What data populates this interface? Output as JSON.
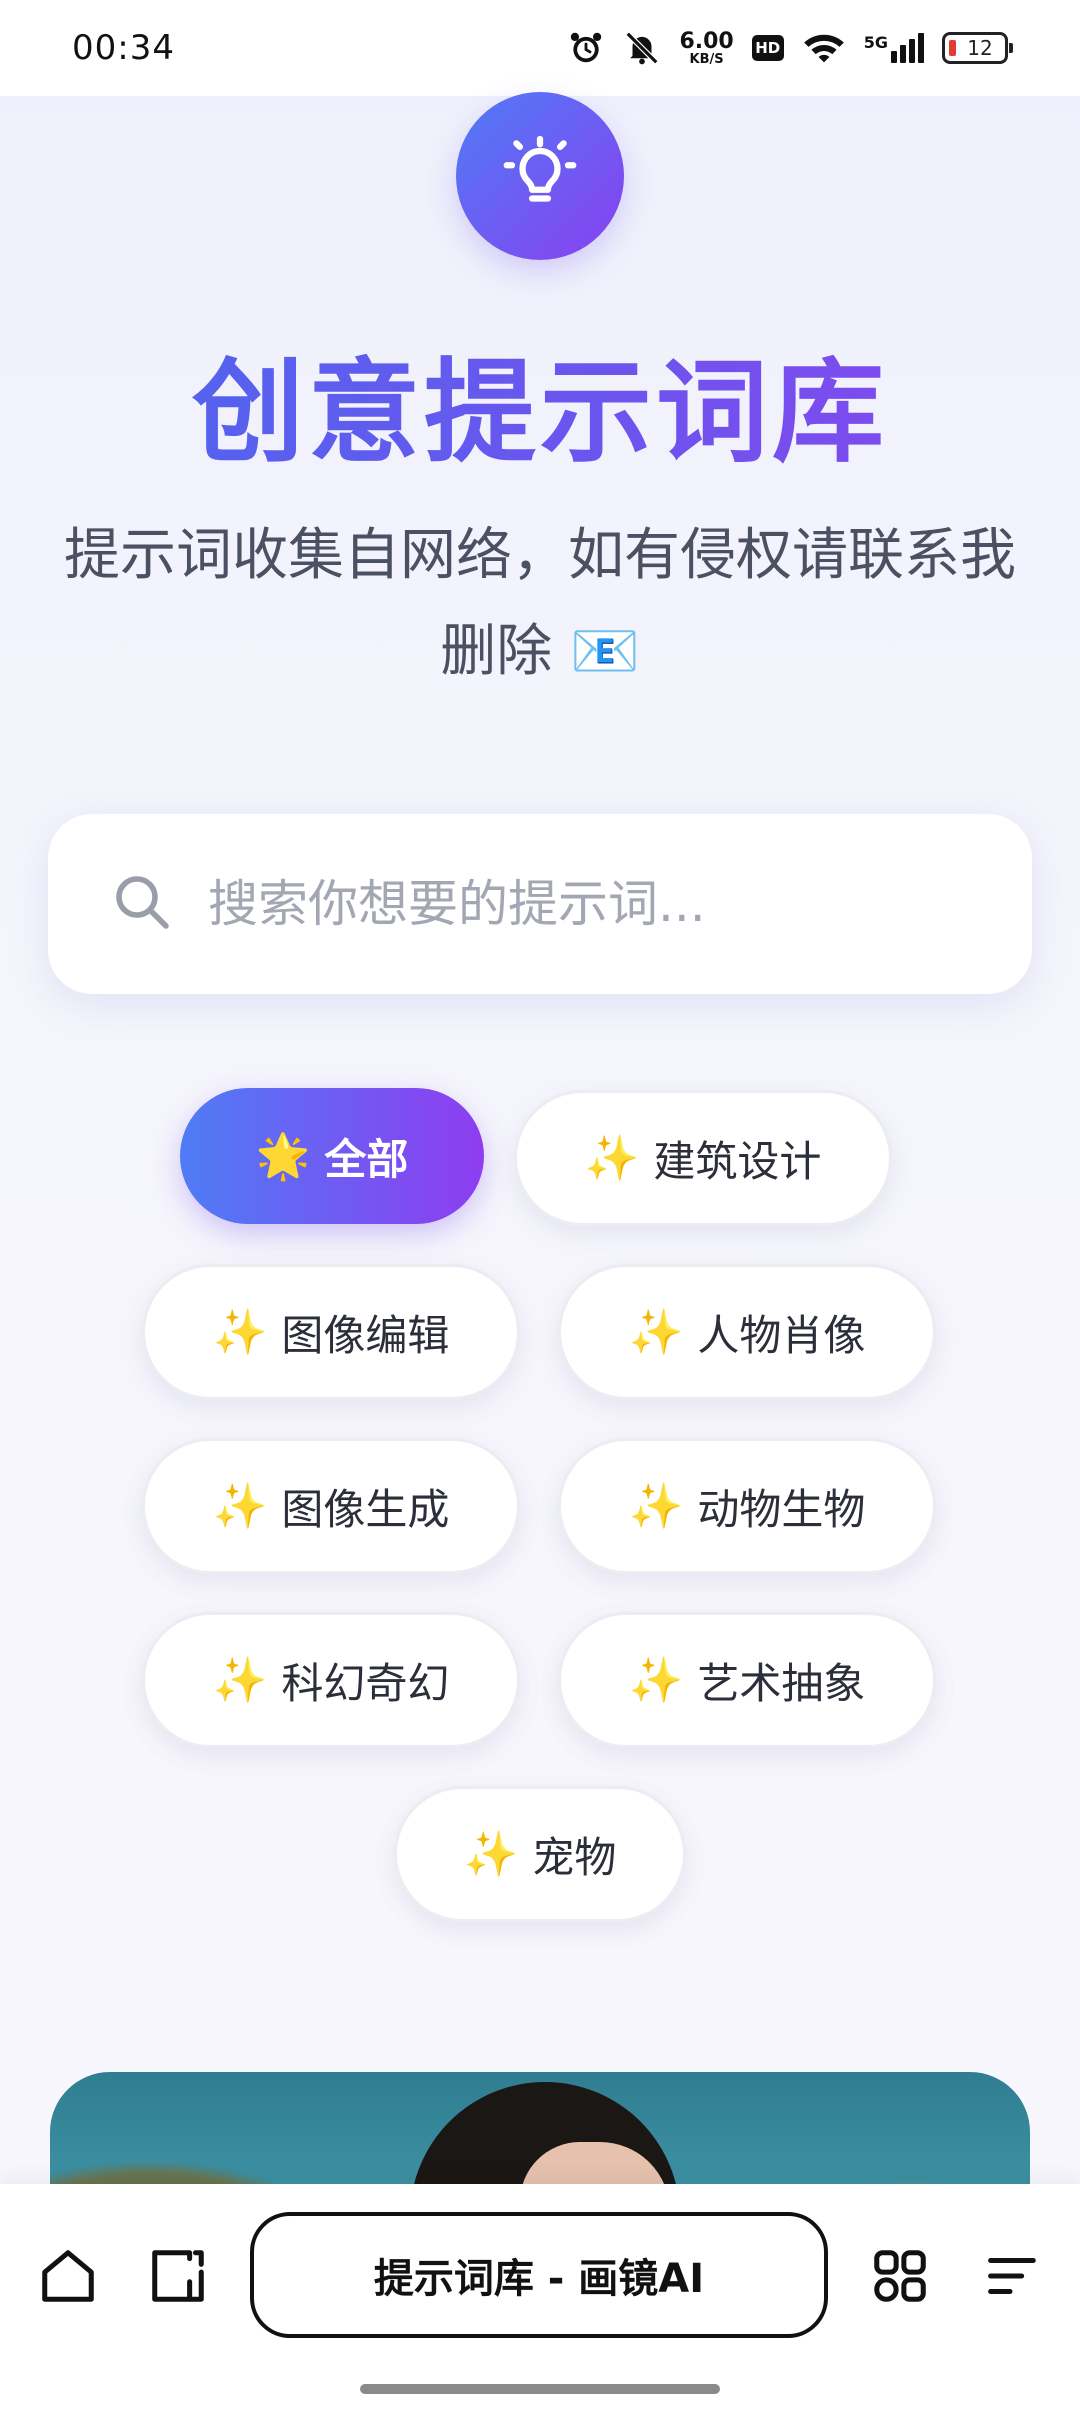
{
  "status_bar": {
    "time": "00:34",
    "speed_value": "6.00",
    "speed_unit": "KB/S",
    "hd": "HD",
    "network": "5G",
    "battery": "12"
  },
  "hero": {
    "icon": "lightbulb-icon",
    "title": "创意提示词库",
    "subtitle": "提示词收集自网络，如有侵权请联系我删除 📧"
  },
  "search": {
    "placeholder": "搜索你想要的提示词..."
  },
  "categories": [
    {
      "emoji": "🌟",
      "label": "全部",
      "active": true
    },
    {
      "emoji": "✨",
      "label": "建筑设计"
    },
    {
      "emoji": "✨",
      "label": "图像编辑"
    },
    {
      "emoji": "✨",
      "label": "人物肖像"
    },
    {
      "emoji": "✨",
      "label": "图像生成"
    },
    {
      "emoji": "✨",
      "label": "动物生物"
    },
    {
      "emoji": "✨",
      "label": "科幻奇幻"
    },
    {
      "emoji": "✨",
      "label": "艺术抽象"
    },
    {
      "emoji": "✨",
      "label": "宠物"
    }
  ],
  "bottom_bar": {
    "page_title": "提示词库 - 画镜AI",
    "icons": [
      "home-icon",
      "tabs-icon",
      "apps-icon",
      "menu-icon"
    ]
  },
  "colors": {
    "accent_start": "#4f7cf5",
    "accent_end": "#8e3df0",
    "text_dark": "#2c2f3a",
    "subtitle": "#4b5162",
    "placeholder": "#a3a7b3"
  }
}
